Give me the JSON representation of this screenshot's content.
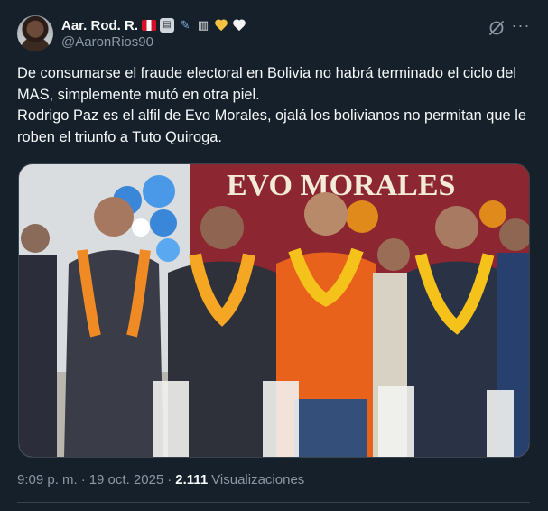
{
  "author": {
    "name": "Aar. Rod. R.",
    "handle": "@AaronRios90",
    "emojis": [
      "peru-flag",
      "newspaper",
      "syringe",
      "open-book",
      "yellow-heart",
      "white-heart"
    ]
  },
  "tweet": {
    "paragraphs": [
      "De consumarse el fraude electoral en Bolivia no habrá terminado el ciclo del MAS, simplemente mutó en otra piel.",
      "Rodrigo Paz es el alfil de Evo Morales, ojalá los bolivianos no permitan que le roben el triunfo a Tuto Quiroga."
    ],
    "banner_text": "EVO MORALES",
    "time": "9:09 p. m.",
    "sep": "·",
    "date": "19 oct. 2025",
    "views_count": "2.111",
    "views_label": "Visualizaciones"
  },
  "colors": {
    "background": "#15202b",
    "text": "#f7f9f9",
    "muted": "#8b98a5",
    "border": "#38444d",
    "banner": "#8c2630",
    "yellow_heart": "#f5c242",
    "white_heart": "#f3f3f3"
  }
}
